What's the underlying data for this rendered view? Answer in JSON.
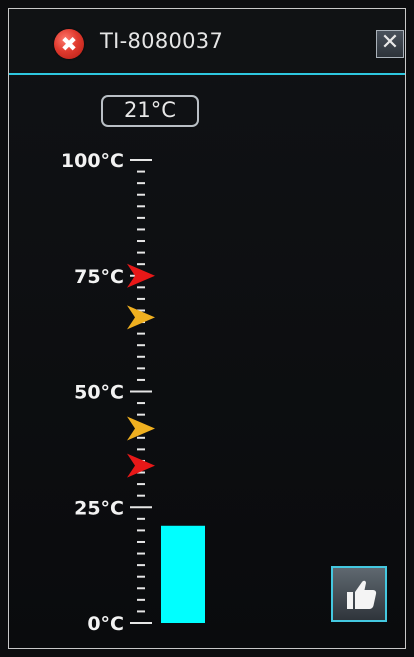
{
  "header": {
    "status_icon": "error-icon",
    "status_symbol": "✖",
    "title": "TI-8080037",
    "close_symbol": "✕"
  },
  "readout": {
    "value": "21°C"
  },
  "scale": {
    "min": 0,
    "max": 100,
    "unit": "°C",
    "labels": [
      "0°C",
      "25°C",
      "50°C",
      "75°C",
      "100°C"
    ],
    "minor_step": 2.5
  },
  "level": {
    "value": 21,
    "color": "#00ffff"
  },
  "alarms": [
    {
      "name": "high-high-alarm-marker",
      "value": 75,
      "color": "#e81818"
    },
    {
      "name": "high-alarm-marker",
      "value": 66,
      "color": "#f0b020"
    },
    {
      "name": "low-alarm-marker",
      "value": 42,
      "color": "#f0b020"
    },
    {
      "name": "low-low-alarm-marker",
      "value": 34,
      "color": "#e81818"
    }
  ],
  "actions": {
    "acknowledge_icon": "thumbs-up-icon"
  },
  "colors": {
    "accent": "#2ec8e0",
    "background": "#0c0d0f",
    "scale": "#e6e6e6"
  }
}
